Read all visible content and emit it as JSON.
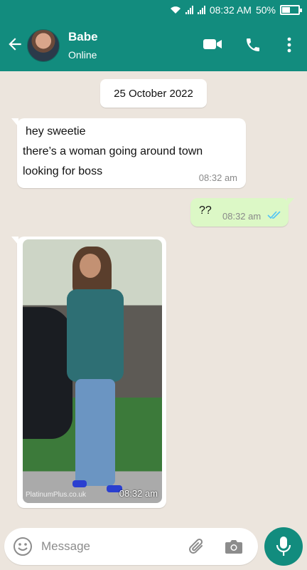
{
  "status_bar": {
    "time": "08:32 AM",
    "battery": "50%",
    "battery_level": 0.5
  },
  "header": {
    "contact_name": "Babe",
    "contact_status": "Online"
  },
  "icons": {
    "back": "arrow-left-icon",
    "video": "video-call-icon",
    "call": "phone-icon",
    "menu": "more-vert-icon",
    "emoji": "emoji-icon",
    "attach": "paperclip-icon",
    "camera": "camera-icon",
    "mic": "mic-icon"
  },
  "colors": {
    "brand": "#128c7e",
    "outgoing": "#dcf8c6",
    "read_ticks": "#4fc3f7"
  },
  "chat": {
    "date": "25 October 2022",
    "messages": [
      {
        "direction": "in",
        "lines": [
          "hey sweetie",
          "there’s a woman going around town",
          "looking for boss"
        ],
        "time": "08:32 am"
      },
      {
        "direction": "out",
        "text": "??",
        "time": "08:32 am",
        "read": true
      },
      {
        "direction": "in",
        "type": "image",
        "watermark": "PlatinumPlus.co.uk",
        "time": "08:32 am"
      }
    ]
  },
  "composer": {
    "placeholder": "Message"
  }
}
